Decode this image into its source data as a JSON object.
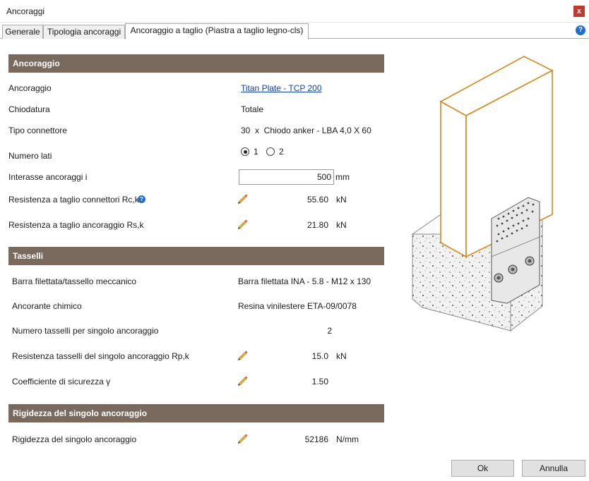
{
  "window": {
    "title": "Ancoraggi",
    "close_label": "x"
  },
  "tabs": [
    {
      "label": "Generale"
    },
    {
      "label": "Tipologia ancoraggi"
    },
    {
      "label": "Ancoraggio a taglio (Piastra a taglio legno-cls)"
    }
  ],
  "help_label": "?",
  "sections": {
    "ancoraggio": {
      "title": "Ancoraggio",
      "rows": {
        "ancoraggio": {
          "label": "Ancoraggio",
          "value": "Titan Plate - TCP 200"
        },
        "chiodatura": {
          "label": "Chiodatura",
          "value": "Totale"
        },
        "tipo_connettore": {
          "label": "Tipo connettore",
          "value": "30  x  Chiodo anker - LBA 4,0 X 60"
        },
        "numero_lati": {
          "label": "Numero lati",
          "option1": "1",
          "option2": "2",
          "selected": "1"
        },
        "interasse": {
          "label": "Interasse ancoraggi i",
          "value": "500",
          "unit": "mm"
        },
        "rck": {
          "label": "Resistenza a taglio connettori Rc,k",
          "value": "55.60",
          "unit": "kN"
        },
        "rsk": {
          "label": "Resistenza a taglio ancoraggio Rs,k",
          "value": "21.80",
          "unit": "kN"
        }
      }
    },
    "tasselli": {
      "title": "Tasselli",
      "rows": {
        "barra": {
          "label": "Barra filettata/tassello meccanico",
          "value": "Barra filettata INA - 5.8 - M12 x 130"
        },
        "ancorante": {
          "label": "Ancorante chimico",
          "value": "Resina vinilestere ETA-09/0078"
        },
        "numero": {
          "label": "Numero tasselli per singolo ancoraggio",
          "value": "2"
        },
        "rpk": {
          "label": "Resistenza tasselli del singolo ancoraggio Rp,k",
          "value": "15.0",
          "unit": "kN"
        },
        "gamma": {
          "label": "Coefficiente di sicurezza γ",
          "value": "1.50"
        }
      }
    },
    "rigidezza": {
      "title": "Rigidezza del singolo ancoraggio",
      "rows": {
        "rigidezza": {
          "label": "Rigidezza del singolo ancoraggio",
          "value": "52186",
          "unit": "N/mm"
        }
      }
    }
  },
  "buttons": {
    "ok": "Ok",
    "cancel": "Annulla"
  },
  "colors": {
    "section_header": "#7a6a5e",
    "link": "#0a3fbf",
    "wood_edge": "#d08a1a",
    "help": "#1e6fd1"
  },
  "icons": [
    "close-icon",
    "help-icon",
    "info-icon",
    "pencil-icon",
    "radio-icon"
  ]
}
